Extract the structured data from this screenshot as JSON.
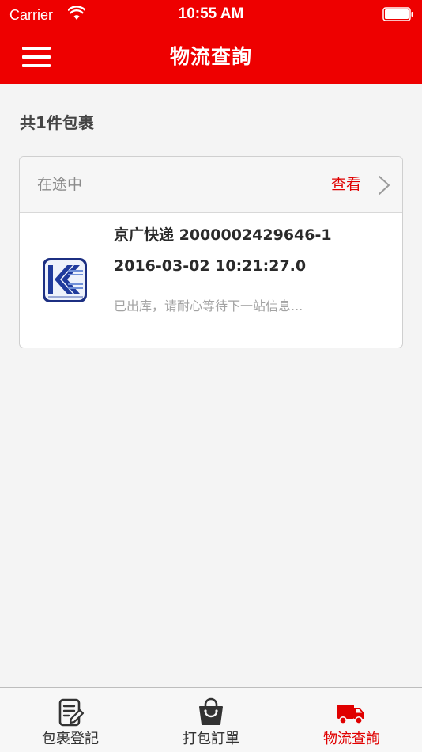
{
  "status_bar": {
    "carrier": "Carrier",
    "time": "10:55 AM"
  },
  "header": {
    "title": "物流查詢",
    "menu_icon": "hamburger-menu-icon"
  },
  "summary": {
    "count_text": "共1件包裹"
  },
  "package": {
    "status": "在途中",
    "view_label": "查看",
    "courier_line": "京广快递 2000002429646-1",
    "datetime": "2016-03-02 10:21:27.0",
    "message": "已出库，请耐心等待下一站信息...",
    "logo_icon": "courier-logo-icon"
  },
  "tabs": [
    {
      "label": "包裹登記",
      "icon": "edit-document-icon",
      "active": false
    },
    {
      "label": "打包訂單",
      "icon": "shopping-bag-icon",
      "active": false
    },
    {
      "label": "物流查詢",
      "icon": "delivery-truck-icon",
      "active": true
    }
  ],
  "colors": {
    "brand_red": "#ee0000",
    "accent_red": "#e00000",
    "background": "#f4f4f4"
  }
}
